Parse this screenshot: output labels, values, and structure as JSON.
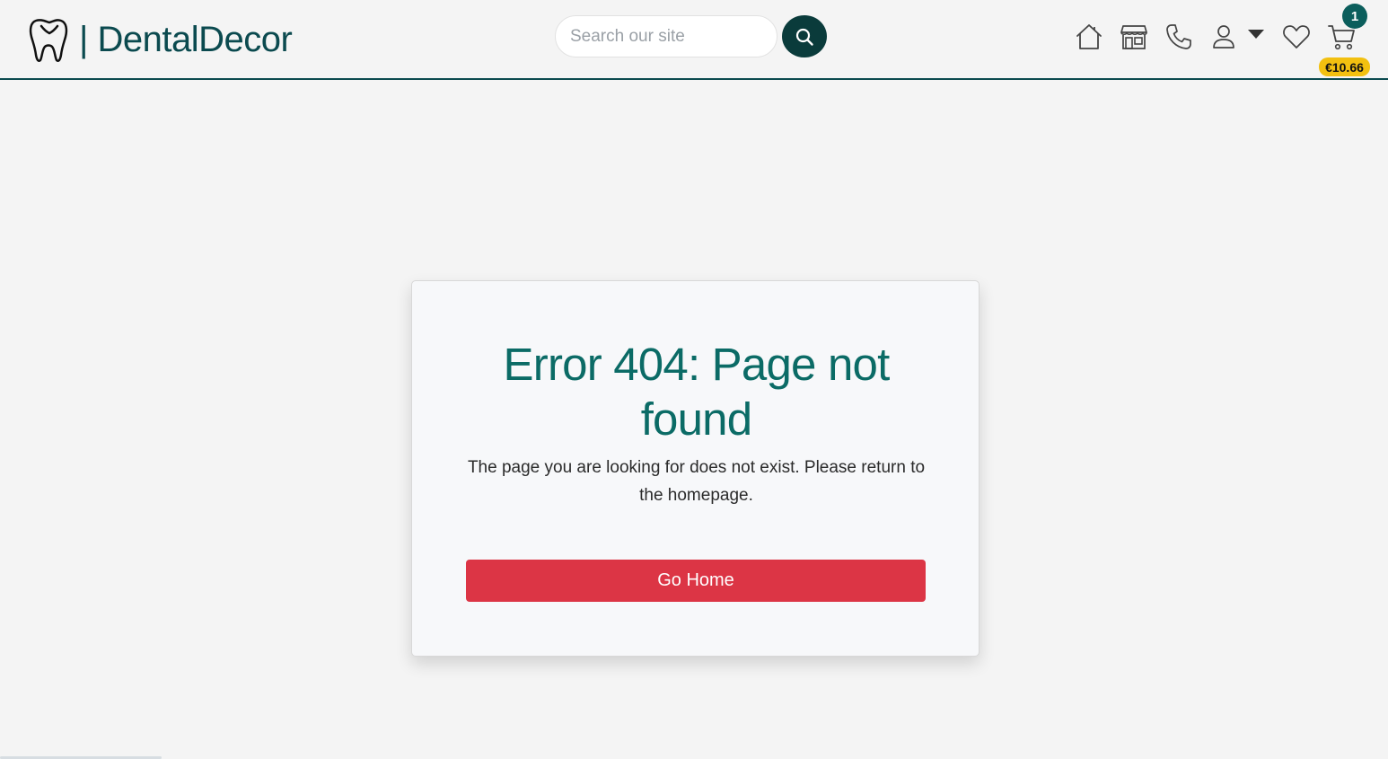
{
  "header": {
    "brand": "| DentalDecor",
    "search_placeholder": "Search our site",
    "cart_count": "1",
    "cart_total": "€10.66"
  },
  "icons": {
    "logo": "tooth-icon",
    "search": "search-icon",
    "home": "home-icon",
    "shop": "store-icon",
    "contact": "phone-icon",
    "account": "user-icon",
    "account_menu": "caret-down-icon",
    "wishlist": "heart-icon",
    "cart": "cart-icon"
  },
  "colors": {
    "brand": "#0b4a4f",
    "title": "#0b6b66",
    "button": "#dc3545",
    "cart_badge": "#0b5e5c",
    "total_badge": "#f2c010"
  },
  "error": {
    "title": "Error 404: Page not found",
    "message": "The page you are looking for does not exist. Please return to the homepage.",
    "button_label": "Go Home"
  }
}
